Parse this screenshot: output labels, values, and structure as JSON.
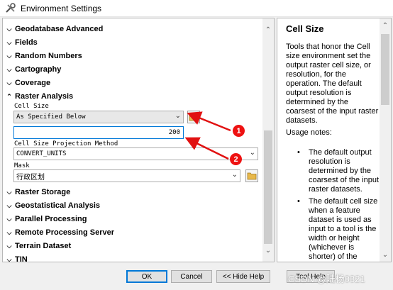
{
  "window": {
    "title": "Environment Settings",
    "app_icon": "tools-icon"
  },
  "sections_top": [
    {
      "label": "Geodatabase Advanced",
      "expanded": false
    },
    {
      "label": "Fields",
      "expanded": false
    },
    {
      "label": "Random Numbers",
      "expanded": false
    },
    {
      "label": "Cartography",
      "expanded": false
    },
    {
      "label": "Coverage",
      "expanded": false
    },
    {
      "label": "Raster Analysis",
      "expanded": true
    }
  ],
  "raster_analysis": {
    "cell_size_label": "Cell Size",
    "cell_size_value": "As Specified Below",
    "cell_size_number": "200",
    "projection_label": "Cell Size Projection Method",
    "projection_value": "CONVERT_UNITS",
    "mask_label": "Mask",
    "mask_value": "行政区划"
  },
  "sections_bottom": [
    {
      "label": "Raster Storage",
      "expanded": false
    },
    {
      "label": "Geostatistical Analysis",
      "expanded": false
    },
    {
      "label": "Parallel Processing",
      "expanded": false
    },
    {
      "label": "Remote Processing Server",
      "expanded": false
    },
    {
      "label": "Terrain Dataset",
      "expanded": false
    },
    {
      "label": "TIN",
      "expanded": false
    }
  ],
  "help": {
    "title": "Cell Size",
    "intro": "Tools that honor the Cell size environment set the output raster cell size, or resolution, for the operation. The default output resolution is determined by the coarsest of the input raster datasets.",
    "usage_heading": "Usage notes:",
    "bullets": [
      "The default output resolution is determined by the coarsest of the input raster datasets.",
      "The default cell size when a feature dataset is used as input to a tool is the width or height (whichever is shorter) of the extent of the feature"
    ]
  },
  "buttons": {
    "ok": "OK",
    "cancel": "Cancel",
    "hide_help": "<< Hide Help",
    "tool_help": "Tool Help"
  },
  "annotations": {
    "marker_1": "1",
    "marker_2": "2",
    "color": "#e11111"
  },
  "watermark": "CSDN @陆杨0321"
}
